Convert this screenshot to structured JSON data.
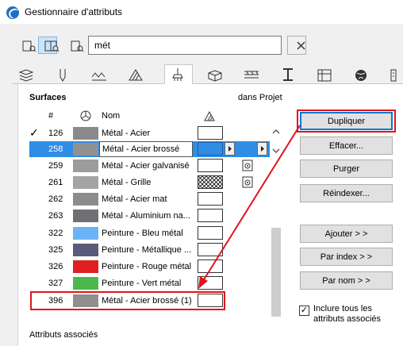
{
  "window": {
    "title": "Gestionnaire d'attributs"
  },
  "search": {
    "value": "mét"
  },
  "panel": {
    "section_label": "Surfaces",
    "project_column_label": "dans Projet",
    "footer_label": "Attributs associés"
  },
  "columns": {
    "number": "#",
    "name": "Nom"
  },
  "rows": [
    {
      "checked": "✓",
      "number": "126",
      "name": "Métal - Acier",
      "color": "#8a8a8a"
    },
    {
      "checked": "",
      "number": "258",
      "name": "Métal - Acier brossé",
      "color": "#919191"
    },
    {
      "checked": "",
      "number": "259",
      "name": "Métal - Acier galvanisé",
      "color": "#9c9c9c"
    },
    {
      "checked": "",
      "number": "261",
      "name": "Métal - Grille",
      "color": "#a4a4a4"
    },
    {
      "checked": "",
      "number": "262",
      "name": "Métal - Acier mat",
      "color": "#8c8c8c"
    },
    {
      "checked": "",
      "number": "263",
      "name": "Métal - Aluminium na...",
      "color": "#6f6f74"
    },
    {
      "checked": "",
      "number": "322",
      "name": "Peinture - Bleu métal",
      "color": "#6ab4f5"
    },
    {
      "checked": "",
      "number": "325",
      "name": "Peinture - Métallique ...",
      "color": "#5a5a7a"
    },
    {
      "checked": "",
      "number": "326",
      "name": "Peinture - Rouge métal",
      "color": "#e02020"
    },
    {
      "checked": "",
      "number": "327",
      "name": "Peinture - Vert métal",
      "color": "#4cb84c"
    },
    {
      "checked": "",
      "number": "396",
      "name": "Métal - Acier brossé (1)",
      "color": "#8f8f8f"
    }
  ],
  "buttons": {
    "duplicate": "Dupliquer",
    "delete": "Effacer...",
    "purge": "Purger",
    "reindex": "Réindexer...",
    "add": "Ajouter > >",
    "by_index": "Par index > >",
    "by_name": "Par nom > >"
  },
  "include": {
    "checked": "✓",
    "label_line1": "Inclure tous les",
    "label_line2": "attributs associés"
  },
  "colors": {
    "selection": "#2f8de4",
    "highlight": "#e0141b",
    "accent": "#0078d7"
  }
}
